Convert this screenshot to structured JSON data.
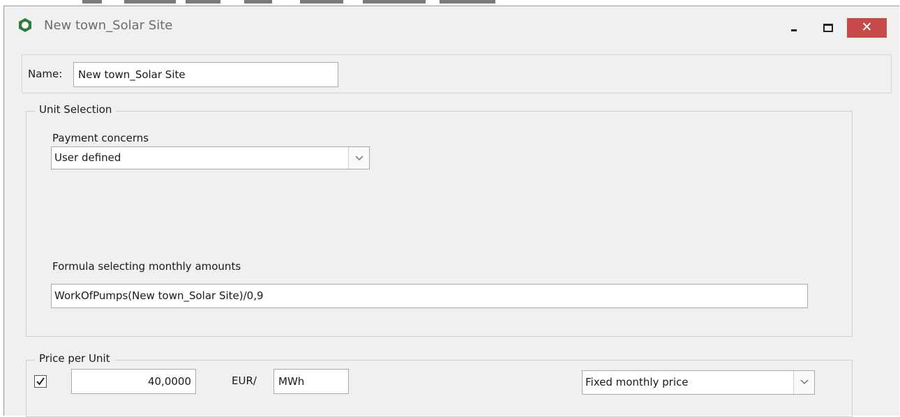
{
  "window": {
    "title": "New town_Solar Site",
    "close_glyph": "✕"
  },
  "name": {
    "label": "Name:",
    "value": "New town_Solar Site"
  },
  "unit_selection": {
    "legend": "Unit Selection",
    "payment_label": "Payment concerns",
    "payment_value": "User defined",
    "formula_label": "Formula selecting monthly amounts",
    "formula_value": "WorkOfPumps(New town_Solar Site)/0,9"
  },
  "price": {
    "legend": "Price per Unit",
    "checked": true,
    "amount": "40,0000",
    "currency": "EUR/",
    "unit": "MWh",
    "mode": "Fixed monthly price"
  },
  "colors": {
    "close_button": "#c74a4a",
    "app_icon": "#2e7d3a"
  }
}
